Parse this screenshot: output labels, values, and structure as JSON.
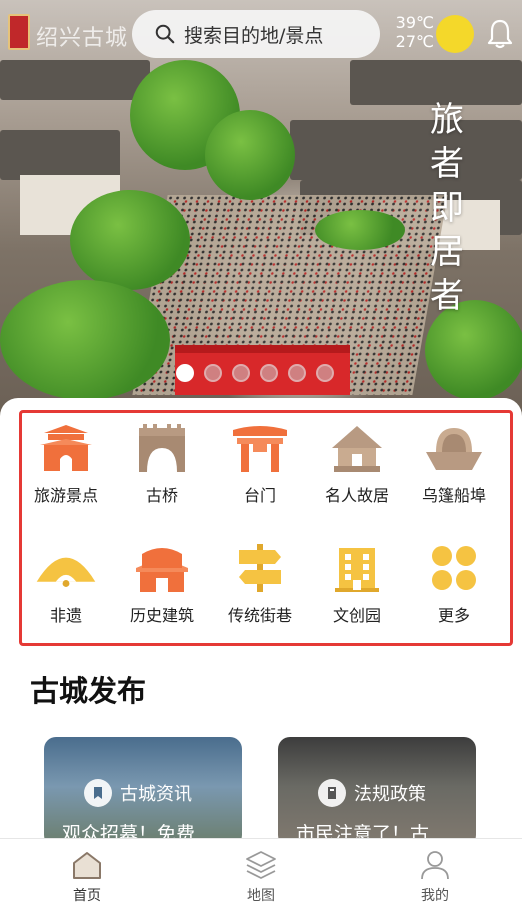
{
  "header": {
    "logo_text": "绍兴古城",
    "search_placeholder": "搜索目的地/景点",
    "weather": {
      "high": "39℃",
      "low": "27℃"
    },
    "slogan": [
      "旅",
      "者",
      "即",
      "居",
      "者"
    ]
  },
  "banner": {
    "slide_count": 6,
    "active_index": 0
  },
  "categories": [
    {
      "label": "旅游景点",
      "icon": "gate-tower-icon"
    },
    {
      "label": "古桥",
      "icon": "bridge-icon"
    },
    {
      "label": "台门",
      "icon": "gateway-icon"
    },
    {
      "label": "名人故居",
      "icon": "residence-icon"
    },
    {
      "label": "乌篷船埠",
      "icon": "boat-icon"
    },
    {
      "label": "非遗",
      "icon": "fan-icon"
    },
    {
      "label": "历史建筑",
      "icon": "pavilion-icon"
    },
    {
      "label": "传统街巷",
      "icon": "signpost-icon"
    },
    {
      "label": "文创园",
      "icon": "building-icon"
    },
    {
      "label": "更多",
      "icon": "more-grid-icon"
    }
  ],
  "section": {
    "title": "古城发布"
  },
  "cards": [
    {
      "tag": "古城资讯",
      "title": "观众招募！免费"
    },
    {
      "tag": "法规政策",
      "title": "市民注意了！古"
    }
  ],
  "tabs": [
    {
      "label": "首页",
      "icon": "home-icon",
      "active": true
    },
    {
      "label": "地图",
      "icon": "map-layers-icon",
      "active": false
    },
    {
      "label": "我的",
      "icon": "profile-icon",
      "active": false
    }
  ],
  "colors": {
    "accent_orange": "#f0703c",
    "accent_gold": "#f5c342",
    "highlight_border": "#e53935",
    "sun": "#f4d82a"
  }
}
